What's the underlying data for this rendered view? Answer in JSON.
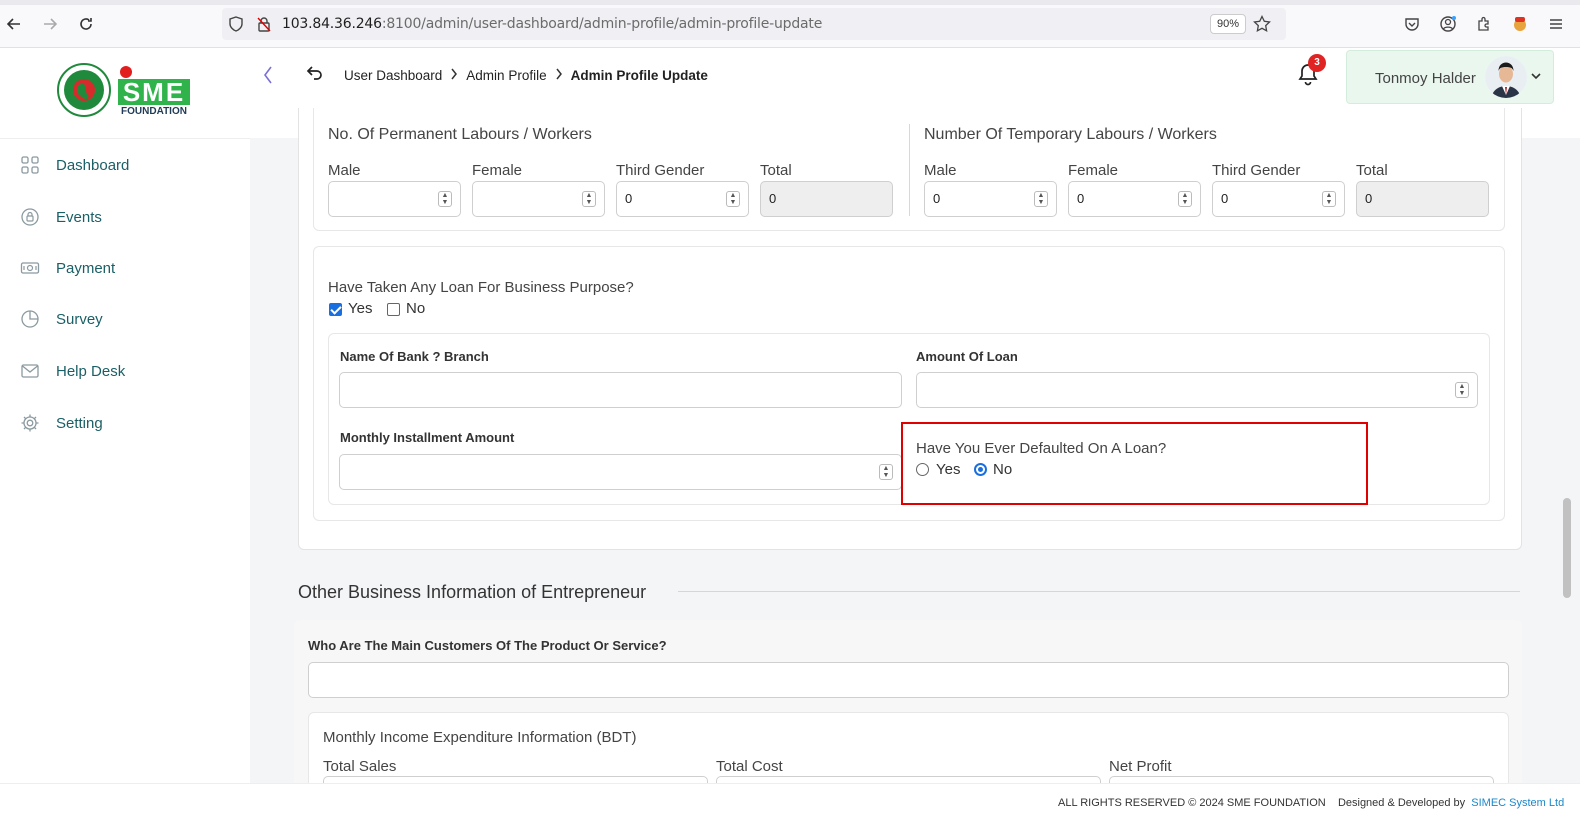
{
  "browser": {
    "url_host": "103.84.36.246",
    "url_path": ":8100/admin/user-dashboard/admin-profile/admin-profile-update",
    "zoom": "90%"
  },
  "header": {
    "breadcrumb": [
      "User Dashboard",
      "Admin Profile",
      "Admin Profile Update"
    ],
    "notification_count": "3",
    "user_name": "Tonmoy Halder"
  },
  "logo": {
    "text": "SME",
    "subtext": "FOUNDATION"
  },
  "sidebar": {
    "items": [
      {
        "label": "Dashboard",
        "icon": "grid-icon"
      },
      {
        "label": "Events",
        "icon": "lock-circle-icon"
      },
      {
        "label": "Payment",
        "icon": "money-icon"
      },
      {
        "label": "Survey",
        "icon": "pie-chart-icon"
      },
      {
        "label": "Help Desk",
        "icon": "mail-icon"
      },
      {
        "label": "Setting",
        "icon": "gear-icon"
      }
    ]
  },
  "labours": {
    "permanent_title": "No. Of Permanent Labours / Workers",
    "temporary_title": "Number Of Temporary Labours / Workers",
    "col_male": "Male",
    "col_female": "Female",
    "col_third": "Third Gender",
    "col_total": "Total",
    "permanent": {
      "male": "",
      "female": "",
      "third": "0",
      "total": "0"
    },
    "temporary": {
      "male": "0",
      "female": "0",
      "third": "0",
      "total": "0"
    }
  },
  "loan": {
    "question": "Have Taken Any Loan For Business Purpose?",
    "yes": "Yes",
    "no": "No",
    "selected": "yes",
    "bank_label": "Name Of Bank ? Branch",
    "amount_label": "Amount Of Loan",
    "installment_label": "Monthly Installment Amount",
    "default_question": "Have You Ever Defaulted On A Loan?",
    "default_selected": "no"
  },
  "other_business": {
    "section_title": "Other Business Information of Entrepreneur",
    "customers_label": "Who Are The Main Customers Of The Product Or Service?",
    "income_title": "Monthly Income Expenditure Information (BDT)",
    "total_sales": "Total Sales",
    "total_cost": "Total Cost",
    "net_profit": "Net Profit"
  },
  "footer": {
    "rights": "ALL RIGHTS RESERVED © 2024 SME FOUNDATION",
    "designed": "Designed & Developed by",
    "developer": "SIMEC System Ltd"
  },
  "colors": {
    "accent": "#1b5f66",
    "highlight": "#e00000",
    "checked": "#1a6fe0"
  }
}
